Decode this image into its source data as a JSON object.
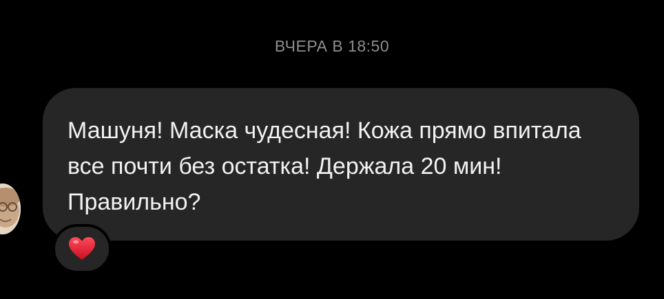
{
  "thread": {
    "timestamp": "ВЧЕРА В 18:50"
  },
  "message": {
    "text": "Машуня! Маска чудесная! Кожа прямо впитала все почти без остатка! Держала 20 мин! Правильно?",
    "reaction": "heart-emoji"
  },
  "colors": {
    "background": "#000000",
    "bubble": "#262626",
    "text": "#f2f2f2",
    "timestamp": "#8e8e93",
    "heart": "#e0162b"
  }
}
